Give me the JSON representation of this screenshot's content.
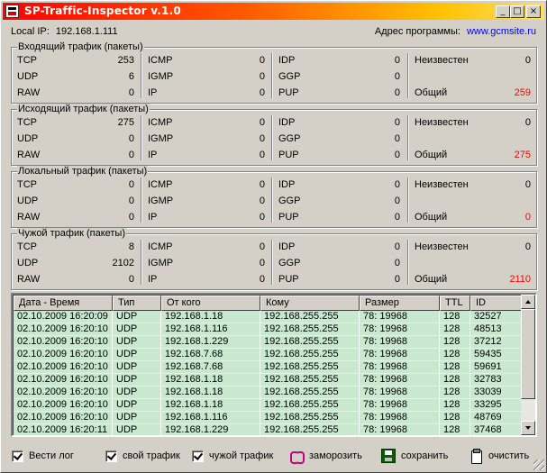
{
  "window": {
    "title": "SP-Traffic-Inspector v.1.0",
    "min_label": "_",
    "max_label": "□",
    "close_label": "×"
  },
  "info": {
    "local_ip_label": "Local IP:",
    "local_ip": "192.168.1.111",
    "program_address_label": "Адрес программы:",
    "program_address": "www.gcmsite.ru"
  },
  "groups": [
    {
      "title": "Входящий трафик (пакеты)",
      "rows": [
        [
          {
            "label": "TCP",
            "value": "253"
          },
          {
            "label": "ICMP",
            "value": "0"
          },
          {
            "label": "IDP",
            "value": "0"
          },
          {
            "label": "Неизвестен",
            "value": "0"
          }
        ],
        [
          {
            "label": "UDP",
            "value": "6"
          },
          {
            "label": "IGMP",
            "value": "0"
          },
          {
            "label": "GGP",
            "value": "0"
          },
          {
            "label": "",
            "value": ""
          }
        ],
        [
          {
            "label": "RAW",
            "value": "0"
          },
          {
            "label": "IP",
            "value": "0"
          },
          {
            "label": "PUP",
            "value": "0"
          },
          {
            "label": "Общий",
            "value": "259"
          }
        ]
      ]
    },
    {
      "title": "Исходящий трафик (пакеты)",
      "rows": [
        [
          {
            "label": "TCP",
            "value": "275"
          },
          {
            "label": "ICMP",
            "value": "0"
          },
          {
            "label": "IDP",
            "value": "0"
          },
          {
            "label": "Неизвестен",
            "value": "0"
          }
        ],
        [
          {
            "label": "UDP",
            "value": "0"
          },
          {
            "label": "IGMP",
            "value": "0"
          },
          {
            "label": "GGP",
            "value": "0"
          },
          {
            "label": "",
            "value": ""
          }
        ],
        [
          {
            "label": "RAW",
            "value": "0"
          },
          {
            "label": "IP",
            "value": "0"
          },
          {
            "label": "PUP",
            "value": "0"
          },
          {
            "label": "Общий",
            "value": "275"
          }
        ]
      ]
    },
    {
      "title": "Локальный трафик (пакеты)",
      "rows": [
        [
          {
            "label": "TCP",
            "value": "0"
          },
          {
            "label": "ICMP",
            "value": "0"
          },
          {
            "label": "IDP",
            "value": "0"
          },
          {
            "label": "Неизвестен",
            "value": "0"
          }
        ],
        [
          {
            "label": "UDP",
            "value": "0"
          },
          {
            "label": "IGMP",
            "value": "0"
          },
          {
            "label": "GGP",
            "value": "0"
          },
          {
            "label": "",
            "value": ""
          }
        ],
        [
          {
            "label": "RAW",
            "value": "0"
          },
          {
            "label": "IP",
            "value": "0"
          },
          {
            "label": "PUP",
            "value": "0"
          },
          {
            "label": "Общий",
            "value": "0"
          }
        ]
      ]
    },
    {
      "title": "Чужой трафик (пакеты)",
      "rows": [
        [
          {
            "label": "TCP",
            "value": "8"
          },
          {
            "label": "ICMP",
            "value": "0"
          },
          {
            "label": "IDP",
            "value": "0"
          },
          {
            "label": "Неизвестен",
            "value": "0"
          }
        ],
        [
          {
            "label": "UDP",
            "value": "2102"
          },
          {
            "label": "IGMP",
            "value": "0"
          },
          {
            "label": "GGP",
            "value": "0"
          },
          {
            "label": "",
            "value": ""
          }
        ],
        [
          {
            "label": "RAW",
            "value": "0"
          },
          {
            "label": "IP",
            "value": "0"
          },
          {
            "label": "PUP",
            "value": "0"
          },
          {
            "label": "Общий",
            "value": "2110"
          }
        ]
      ]
    }
  ],
  "table": {
    "columns": [
      "Дата - Время",
      "Тип",
      "От кого",
      "Кому",
      "Размер",
      "TTL",
      "ID"
    ],
    "rows": [
      [
        "02.10.2009 16:20:09",
        "UDP",
        "192.168.1.18",
        "192.168.255.255",
        "78: 19968",
        "128",
        "32527"
      ],
      [
        "02.10.2009 16:20:10",
        "UDP",
        "192.168.1.116",
        "192.168.255.255",
        "78: 19968",
        "128",
        "48513"
      ],
      [
        "02.10.2009 16:20:10",
        "UDP",
        "192.168.1.229",
        "192.168.255.255",
        "78: 19968",
        "128",
        "37212"
      ],
      [
        "02.10.2009 16:20:10",
        "UDP",
        "192.168.7.68",
        "192.168.255.255",
        "78: 19968",
        "128",
        "59435"
      ],
      [
        "02.10.2009 16:20:10",
        "UDP",
        "192.168.7.68",
        "192.168.255.255",
        "78: 19968",
        "128",
        "59691"
      ],
      [
        "02.10.2009 16:20:10",
        "UDP",
        "192.168.1.18",
        "192.168.255.255",
        "78: 19968",
        "128",
        "32783"
      ],
      [
        "02.10.2009 16:20:10",
        "UDP",
        "192.168.1.18",
        "192.168.255.255",
        "78: 19968",
        "128",
        "33039"
      ],
      [
        "02.10.2009 16:20:10",
        "UDP",
        "192.168.1.18",
        "192.168.255.255",
        "78: 19968",
        "128",
        "33295"
      ],
      [
        "02.10.2009 16:20:10",
        "UDP",
        "192.168.1.116",
        "192.168.255.255",
        "78: 19968",
        "128",
        "48769"
      ],
      [
        "02.10.2009 16:20:11",
        "UDP",
        "192.168.1.229",
        "192.168.255.255",
        "78: 19968",
        "128",
        "37468"
      ]
    ]
  },
  "bottom": {
    "log_label": "Вести лог",
    "own_traffic_label": "свой трафик",
    "foreign_traffic_label": "чужой трафик",
    "freeze_label": "заморозить",
    "save_label": "сохранить",
    "clear_label": "очистить"
  },
  "colors": {
    "red_total": "#ff0000",
    "row_bg": "#c8e8d0",
    "link": "#0000ff"
  }
}
